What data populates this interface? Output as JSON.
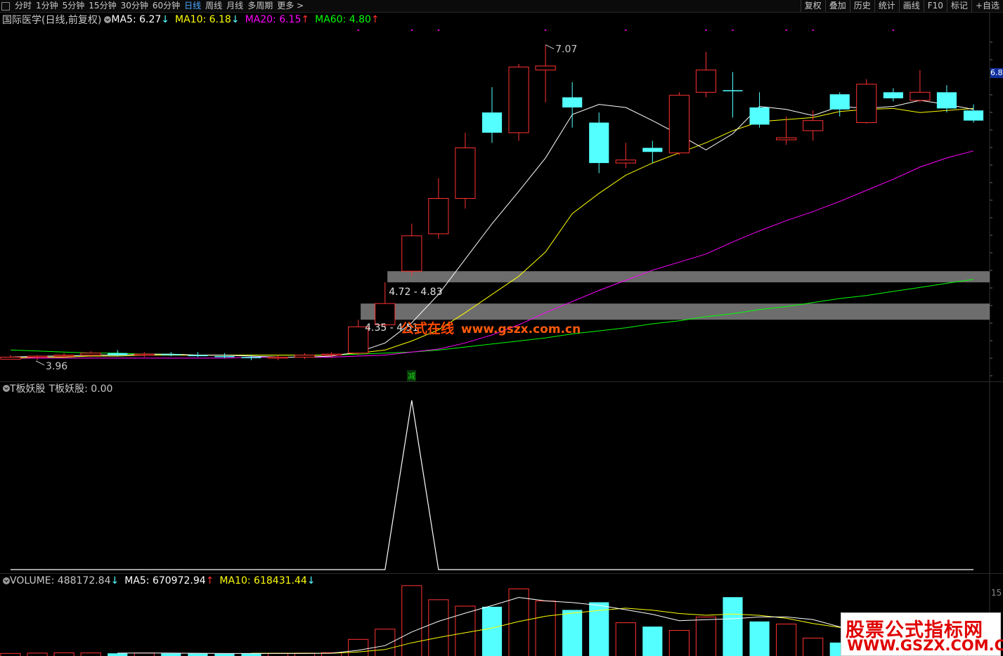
{
  "toolbar": {
    "periods": [
      "分时",
      "1分钟",
      "5分钟",
      "15分钟",
      "30分钟",
      "60分钟",
      "日线",
      "周线",
      "月线",
      "多周期",
      "更多 >"
    ],
    "active_period": "日线",
    "right_buttons": [
      "复权",
      "叠加",
      "历史",
      "统计",
      "画线",
      "F10",
      "标记",
      "+自选"
    ]
  },
  "main_panel": {
    "title": "国际医学(日线,前复权)",
    "indicators": [
      {
        "label": "MA5: 6.27",
        "arrow": "↓",
        "color": "#ffffff"
      },
      {
        "label": "MA10: 6.18",
        "arrow": "↓",
        "color": "#ffff00"
      },
      {
        "label": "MA20: 6.15",
        "arrow": "↑",
        "color": "#ff00ff"
      },
      {
        "label": "MA60: 4.80",
        "arrow": "↑",
        "color": "#00ff00"
      }
    ],
    "high_label": "7.07",
    "low_label": "3.96",
    "zone1_label": "4.72 - 4.83",
    "zone2_label": "4.35 - 4.51",
    "right_price_tag": "6.8",
    "signal_badge": "减",
    "watermark_cn": "公式在线",
    "watermark_url": "www.gszx.com.cn"
  },
  "sub_panel": {
    "title": "T板妖股",
    "value_label": "T板妖股: 0.00"
  },
  "volume_panel": {
    "volume_label": "VOLUME: 488172.84",
    "volume_arrow": "↓",
    "ma5_label": "MA5: 670972.94",
    "ma5_arrow": "↑",
    "ma10_label": "MA10: 618431.44",
    "ma10_arrow": "↓",
    "right_axis_tick": "15"
  },
  "logo": {
    "line1": "股票公式指标网",
    "line2": "WWW.GSZX.COM.CN"
  },
  "colors": {
    "up": "#ff3232",
    "down": "#54ffff",
    "ma5": "#ffffff",
    "ma10": "#ffff00",
    "ma20": "#ff00ff",
    "ma60": "#00ff00",
    "zone": "#808080"
  },
  "chart_data": {
    "type": "candlestick",
    "price_axis_range": [
      3.9,
      7.2
    ],
    "candles": [
      {
        "o": 3.96,
        "h": 4.0,
        "l": 3.96,
        "c": 3.98
      },
      {
        "o": 3.98,
        "h": 4.0,
        "l": 3.95,
        "c": 3.99
      },
      {
        "o": 3.99,
        "h": 4.02,
        "l": 3.97,
        "c": 4.0
      },
      {
        "o": 4.0,
        "h": 4.04,
        "l": 3.98,
        "c": 4.02
      },
      {
        "o": 4.02,
        "h": 4.05,
        "l": 3.99,
        "c": 4.0
      },
      {
        "o": 4.0,
        "h": 4.03,
        "l": 3.98,
        "c": 4.01
      },
      {
        "o": 4.01,
        "h": 4.03,
        "l": 3.99,
        "c": 4.0
      },
      {
        "o": 4.0,
        "h": 4.03,
        "l": 3.98,
        "c": 3.99
      },
      {
        "o": 3.99,
        "h": 4.02,
        "l": 3.97,
        "c": 3.98
      },
      {
        "o": 3.98,
        "h": 4.0,
        "l": 3.95,
        "c": 3.97
      },
      {
        "o": 3.97,
        "h": 4.0,
        "l": 3.95,
        "c": 3.98
      },
      {
        "o": 3.98,
        "h": 4.02,
        "l": 3.96,
        "c": 4.0
      },
      {
        "o": 4.0,
        "h": 4.03,
        "l": 3.98,
        "c": 4.01
      },
      {
        "o": 4.02,
        "h": 4.35,
        "l": 4.0,
        "c": 4.28
      },
      {
        "o": 4.3,
        "h": 4.72,
        "l": 4.27,
        "c": 4.51
      },
      {
        "o": 4.83,
        "h": 5.3,
        "l": 4.78,
        "c": 5.18
      },
      {
        "o": 5.2,
        "h": 5.75,
        "l": 5.15,
        "c": 5.55
      },
      {
        "o": 5.55,
        "h": 6.2,
        "l": 5.45,
        "c": 6.05
      },
      {
        "o": 6.4,
        "h": 6.65,
        "l": 6.1,
        "c": 6.2
      },
      {
        "o": 6.2,
        "h": 6.88,
        "l": 6.12,
        "c": 6.85
      },
      {
        "o": 6.82,
        "h": 7.07,
        "l": 6.5,
        "c": 6.86
      },
      {
        "o": 6.55,
        "h": 6.7,
        "l": 6.25,
        "c": 6.45
      },
      {
        "o": 6.3,
        "h": 6.4,
        "l": 5.8,
        "c": 5.9
      },
      {
        "o": 5.9,
        "h": 6.1,
        "l": 5.85,
        "c": 5.93
      },
      {
        "o": 6.05,
        "h": 6.12,
        "l": 5.9,
        "c": 6.01
      },
      {
        "o": 6.0,
        "h": 6.6,
        "l": 5.98,
        "c": 6.57
      },
      {
        "o": 6.6,
        "h": 7.0,
        "l": 6.55,
        "c": 6.82
      },
      {
        "o": 6.62,
        "h": 6.8,
        "l": 6.35,
        "c": 6.61
      },
      {
        "o": 6.45,
        "h": 6.6,
        "l": 6.25,
        "c": 6.28
      },
      {
        "o": 6.13,
        "h": 6.36,
        "l": 6.08,
        "c": 6.15
      },
      {
        "o": 6.22,
        "h": 6.42,
        "l": 6.12,
        "c": 6.32
      },
      {
        "o": 6.58,
        "h": 6.6,
        "l": 6.36,
        "c": 6.43
      },
      {
        "o": 6.3,
        "h": 6.73,
        "l": 6.29,
        "c": 6.68
      },
      {
        "o": 6.6,
        "h": 6.64,
        "l": 6.51,
        "c": 6.54
      },
      {
        "o": 6.52,
        "h": 6.82,
        "l": 6.5,
        "c": 6.6
      },
      {
        "o": 6.6,
        "h": 6.67,
        "l": 6.4,
        "c": 6.44
      },
      {
        "o": 6.42,
        "h": 6.48,
        "l": 6.3,
        "c": 6.32
      }
    ],
    "ma5": [
      3.98,
      3.99,
      3.99,
      4.0,
      4.0,
      4.01,
      4.01,
      4.0,
      4.0,
      3.99,
      3.98,
      3.98,
      3.99,
      4.03,
      4.12,
      4.32,
      4.6,
      4.95,
      5.3,
      5.62,
      5.95,
      6.38,
      6.48,
      6.45,
      6.32,
      6.18,
      6.03,
      6.19,
      6.46,
      6.43,
      6.37,
      6.46,
      6.44,
      6.46,
      6.52,
      6.48,
      6.43
    ],
    "ma10": [
      3.97,
      3.98,
      3.98,
      3.99,
      3.99,
      4.0,
      4.0,
      4.0,
      4.0,
      4.0,
      4.0,
      4.0,
      4.0,
      4.02,
      4.05,
      4.14,
      4.25,
      4.42,
      4.6,
      4.78,
      5.02,
      5.4,
      5.6,
      5.78,
      5.9,
      6.0,
      6.1,
      6.22,
      6.31,
      6.33,
      6.35,
      6.41,
      6.43,
      6.44,
      6.4,
      6.42,
      6.44
    ],
    "ma20": [
      3.97,
      3.97,
      3.97,
      3.97,
      3.97,
      3.97,
      3.97,
      3.97,
      3.97,
      3.98,
      3.98,
      3.98,
      3.98,
      3.99,
      4.0,
      4.03,
      4.06,
      4.12,
      4.2,
      4.3,
      4.42,
      4.53,
      4.64,
      4.74,
      4.84,
      4.92,
      5.0,
      5.12,
      5.23,
      5.33,
      5.42,
      5.52,
      5.63,
      5.74,
      5.86,
      5.95,
      6.02
    ],
    "ma60": [
      4.05,
      4.04,
      4.03,
      4.02,
      4.02,
      4.01,
      4.01,
      4.0,
      4.0,
      4.0,
      4.0,
      4.0,
      4.0,
      4.01,
      4.02,
      4.03,
      4.05,
      4.08,
      4.11,
      4.14,
      4.17,
      4.21,
      4.24,
      4.27,
      4.31,
      4.34,
      4.38,
      4.41,
      4.45,
      4.48,
      4.52,
      4.56,
      4.59,
      4.63,
      4.67,
      4.71,
      4.75
    ],
    "zones": [
      [
        4.72,
        4.83
      ],
      [
        4.35,
        4.51
      ]
    ],
    "indicator_T": {
      "peak_index": 15,
      "peak_value": 1,
      "baseline": 0
    },
    "volume": [
      40000,
      45000,
      50000,
      48000,
      42000,
      46000,
      40000,
      38000,
      36000,
      39000,
      41000,
      45000,
      52000,
      260000,
      420000,
      1100000,
      880000,
      780000,
      770000,
      1050000,
      860000,
      720000,
      840000,
      520000,
      460000,
      400000,
      610000,
      920000,
      540000,
      500000,
      280000,
      210000,
      300000,
      240000,
      330000,
      380000,
      488172
    ],
    "volume_ma5": [
      null,
      null,
      null,
      null,
      45000,
      46000,
      45000,
      43000,
      40000,
      40000,
      39000,
      40000,
      44000,
      89000,
      162000,
      375000,
      542000,
      670000,
      790000,
      916000,
      862000,
      836000,
      792000,
      724000,
      652000,
      552000,
      568000,
      582000,
      610000,
      610000,
      570000,
      456000,
      390000,
      306000,
      316000,
      334000,
      670972
    ],
    "volume_ma10": [
      null,
      null,
      null,
      null,
      null,
      null,
      null,
      null,
      null,
      42500,
      42600,
      42600,
      42700,
      64000,
      101000,
      206000,
      290000,
      364000,
      437000,
      539000,
      622000,
      670000,
      713000,
      748000,
      717000,
      664000,
      637000,
      656000,
      636000,
      591000,
      507000,
      448000,
      430000,
      408000,
      399000,
      384000,
      618431
    ]
  }
}
